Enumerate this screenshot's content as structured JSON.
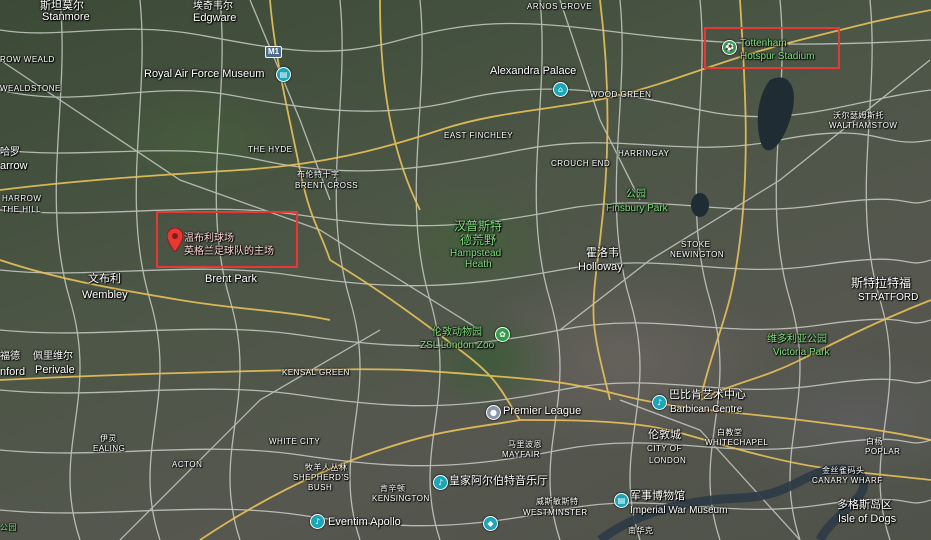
{
  "labels": {
    "stanmore_cn": "斯坦莫尔",
    "stanmore": "Stanmore",
    "edgware_cn": "埃奇韦尔",
    "edgware": "Edgware",
    "arnos_grove": "ARNOS GROVE",
    "m1": "M1",
    "row_weald": "ROW WEALD",
    "wealdstone": "WEALDSTONE",
    "raf_museum": "Royal Air Force Museum",
    "alexandra_palace": "Alexandra Palace",
    "wood_green": "WOOD GREEN",
    "east_finchley": "EAST FINCHLEY",
    "harringay": "HARRINGAY",
    "the_hyde": "THE HYDE",
    "crouch_end": "CROUCH END",
    "harrow_cn": "哈罗",
    "harrow": "arrow",
    "brent_cross_cn": "布伦特十字",
    "brent_cross": "BRENT CROSS",
    "harrow_on_hill_1": "HARROW",
    "harrow_on_hill_2": "THE HILL",
    "hampstead_cn_1": "汉普斯特",
    "hampstead_cn_2": "德荒野",
    "hampstead_1": "Hampstead",
    "hampstead_2": "Heath",
    "park_cn": "公园",
    "finsbury_park": "Finsbury Park",
    "holloway_cn": "霍洛韦",
    "holloway": "Holloway",
    "stoke_1": "STOKE",
    "stoke_2": "NEWINGTON",
    "wembley_cn": "文布利",
    "wembley": "Wembley",
    "brent_park": "Brent Park",
    "stratford_cn": "斯特拉特福",
    "stratford": "STRATFORD",
    "walthamstow_cn": "沃尔瑟姆斯托",
    "walthamstow": "WALTHAMSTOW",
    "zsl_cn": "伦敦动物园",
    "zsl": "ZSL London Zoo",
    "victoria_cn": "维多利亚公园",
    "victoria": "Victoria Park",
    "perivale_cn": "佩里维尔",
    "perivale": "Perivale",
    "ford_cn": "福德",
    "ford": "nford",
    "kensal_green": "KENSAL GREEN",
    "barbican_cn": "巴比肯艺术中心",
    "barbican": "Barbican Centre",
    "premier_league": "Premier League",
    "marylebone_cn": "马里波恩",
    "mayfair": "MAYFAIR",
    "white_city": "WHITE CITY",
    "ealing_cn": "伊灵",
    "ealing": "EALING",
    "acton": "ACTON",
    "city_cn": "伦敦城",
    "city_1": "CITY OF",
    "city_2": "LONDON",
    "whitechapel_cn": "白教堂",
    "whitechapel": "WHITECHAPEL",
    "poplar_cn": "白杨",
    "poplar": "POPLAR",
    "shepherds_cn": "牧羊人丛林",
    "shepherds_1": "SHEPHERD'S",
    "shepherds_2": "BUSH",
    "kensington_cn": "肯辛顿",
    "kensington": "KENSINGTON",
    "rah_cn": "皇家阿尔伯特音乐厅",
    "canary_cn": "金丝雀码头",
    "canary": "CANARY WHARF",
    "iwm_cn": "军事博物馆",
    "iwm": "Imperial War Museum",
    "westminster_cn": "威斯敏斯特",
    "westminster": "WESTMINSTER",
    "isle_cn": "多格斯岛区",
    "isle": "Isle of Dogs",
    "eventim": "Eventim Apollo",
    "park_left_cn": "公园",
    "south_cn": "南华克"
  },
  "highlights": {
    "tottenham_1": "Tottenham",
    "tottenham_2": "Hotspur Stadium",
    "wembley_1": "温布利球场",
    "wembley_2": "英格兰足球队的主场"
  },
  "colors": {
    "road_major": "#e8c25a",
    "road_minor": "#d9dcd6",
    "highlight": "#e53935",
    "pin": "#e53935",
    "poi_blue": "#1aa6b7",
    "poi_green": "#2f9e44"
  }
}
